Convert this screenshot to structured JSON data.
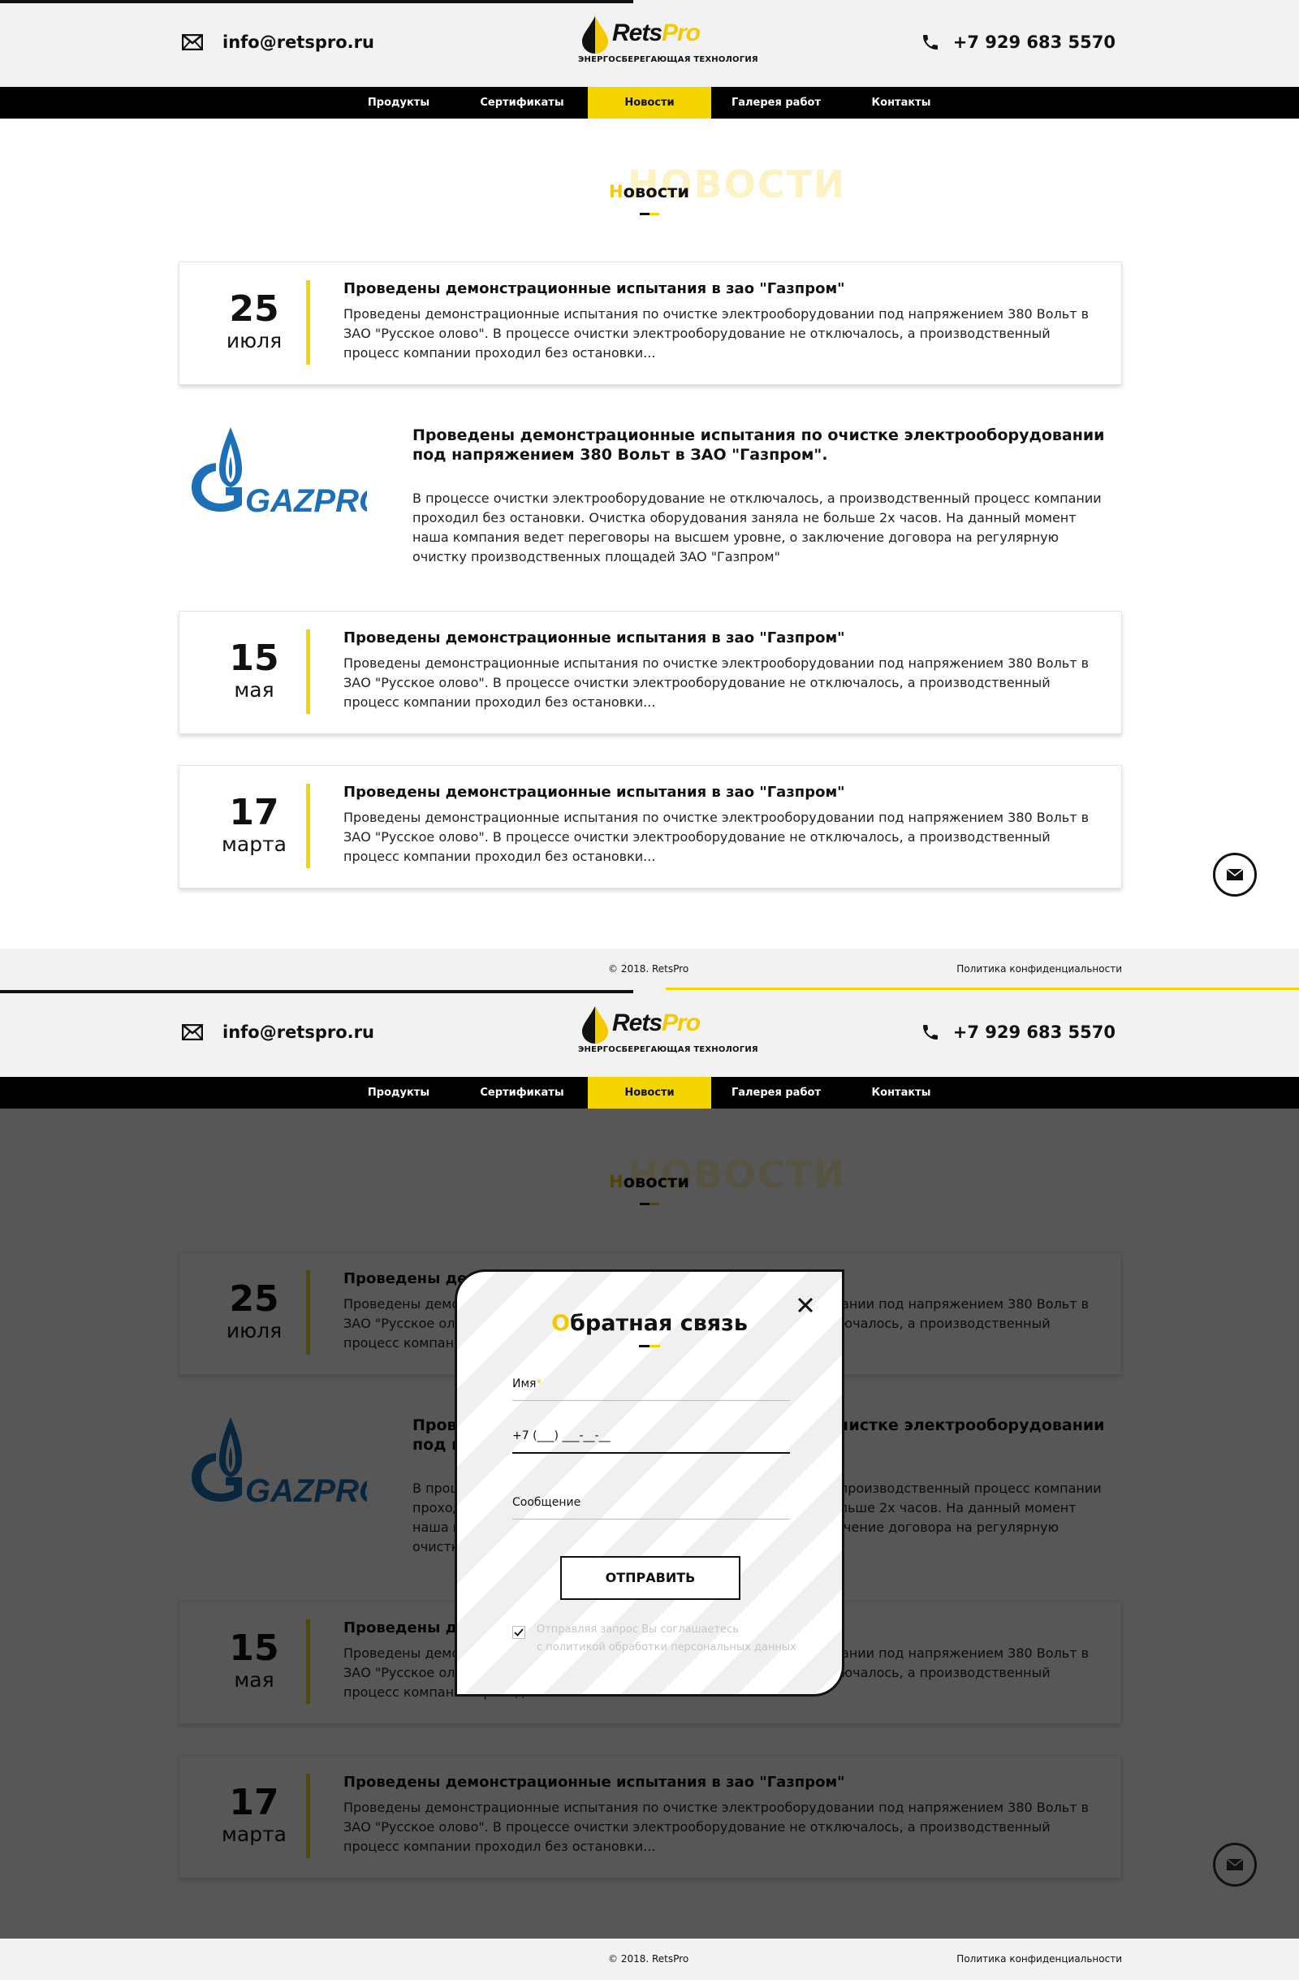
{
  "header": {
    "email": "info@retspro.ru",
    "phone": "+7 929 683 5570",
    "logo_rets": "Rets",
    "logo_pro": "Pro",
    "logo_tagline": "ЭНЕРГОСБЕРЕГАЮЩАЯ ТЕХНОЛОГИЯ"
  },
  "nav": {
    "items": [
      {
        "label": "Продукты"
      },
      {
        "label": "Сертификаты"
      },
      {
        "label": "Новости"
      },
      {
        "label": "Галерея работ"
      },
      {
        "label": "Контакты"
      }
    ],
    "active_index": 2
  },
  "section": {
    "ghost": "НОВОСТИ",
    "title_first": "Н",
    "title_rest": "овости"
  },
  "news": [
    {
      "day": "25",
      "month": "июля",
      "title": "Проведены демонстрационные испытания в зао \"Газпром\"",
      "text": "Проведены демонстрационные испытания по очистке электрооборудовании под напряжением 380 Вольт в ЗАО \"Русское олово\". В процессе очистки электрооборудование не отключалось, а производственный процесс компании проходил без остановки..."
    },
    {
      "day": "15",
      "month": "мая",
      "title": "Проведены демонстрационные испытания в зао \"Газпром\"",
      "text": "Проведены демонстрационные испытания по очистке электрооборудовании под напряжением 380 Вольт в ЗАО \"Русское олово\". В процессе очистки электрооборудование не отключалось, а производственный процесс компании проходил без остановки..."
    },
    {
      "day": "17",
      "month": "марта",
      "title": "Проведены демонстрационные испытания в зао \"Газпром\"",
      "text": "Проведены демонстрационные испытания по очистке электрооборудовании под напряжением 380 Вольт в ЗАО \"Русское олово\". В процессе очистки электрооборудование не отключалось, а производственный процесс компании проходил без остановки..."
    }
  ],
  "feature": {
    "logo_text": "GAZPROM",
    "title": "Проведены демонстрационные испытания по очистке электрооборудовании под напряжением 380 Вольт в ЗАО \"Газпром\".",
    "text": "В процессе очистки электрооборудование не отключалось, а производственный процесс компании проходил без остановки. Очистка оборудования заняла не больше 2х часов. На данный момент наша компания ведет переговоры на высшем уровне, о заключение договора на регулярную очистку производственных площадей ЗАО \"Газпром\""
  },
  "footer": {
    "copyright": "© 2018. RetsPro",
    "policy": "Политика конфиденциальности"
  },
  "modal": {
    "title_first": "О",
    "title_rest": "братная связь",
    "name_label": "Имя",
    "name_required_mark": "*",
    "phone_mask": "+7 (___) ___-__-__",
    "message_label": "Сообщение",
    "submit": "ОТПРАВИТЬ",
    "agree_line1": "Отправляя запрос Вы соглашаетесь",
    "agree_line2": "с политикой обработки персональных данных",
    "agree_checked": true
  },
  "colors": {
    "accent": "#f4d500",
    "dark": "#111111",
    "gazprom_blue": "#1d6fb8"
  }
}
